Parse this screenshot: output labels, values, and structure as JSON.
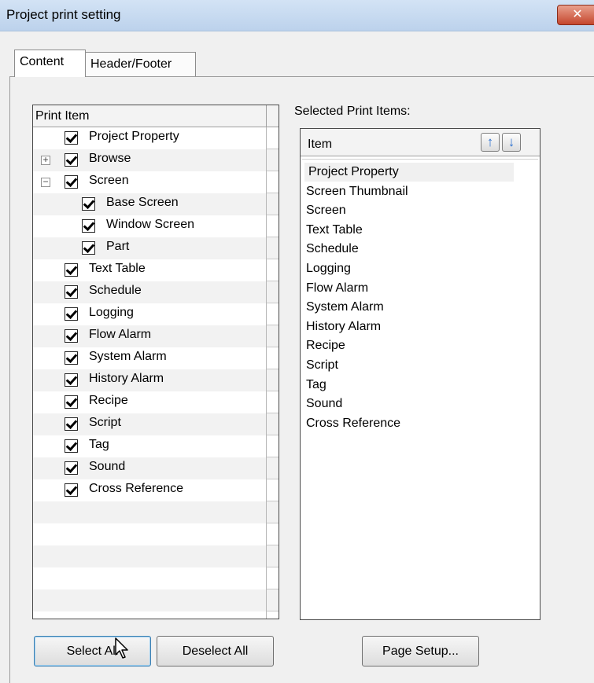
{
  "window": {
    "title": "Project print setting",
    "close_label": "✕"
  },
  "tabs": [
    {
      "label": "Content",
      "active": true
    },
    {
      "label": "Header/Footer",
      "active": false
    }
  ],
  "tree": {
    "header": "Print Item",
    "items": [
      {
        "label": "Project Property",
        "checked": true,
        "level": 1
      },
      {
        "label": "Browse",
        "checked": true,
        "level": 1,
        "expander": "+"
      },
      {
        "label": "Screen",
        "checked": true,
        "level": 1,
        "expander": "−"
      },
      {
        "label": "Base Screen",
        "checked": true,
        "level": 2
      },
      {
        "label": "Window Screen",
        "checked": true,
        "level": 2
      },
      {
        "label": "Part",
        "checked": true,
        "level": 2
      },
      {
        "label": "Text Table",
        "checked": true,
        "level": 0
      },
      {
        "label": "Schedule",
        "checked": true,
        "level": 0
      },
      {
        "label": "Logging",
        "checked": true,
        "level": 0
      },
      {
        "label": "Flow Alarm",
        "checked": true,
        "level": 0
      },
      {
        "label": "System Alarm",
        "checked": true,
        "level": 0
      },
      {
        "label": "History Alarm",
        "checked": true,
        "level": 0
      },
      {
        "label": "Recipe",
        "checked": true,
        "level": 0
      },
      {
        "label": "Script",
        "checked": true,
        "level": 0
      },
      {
        "label": "Tag",
        "checked": true,
        "level": 0
      },
      {
        "label": "Sound",
        "checked": true,
        "level": 0
      },
      {
        "label": "Cross Reference",
        "checked": true,
        "level": 0
      }
    ]
  },
  "selected": {
    "title": "Selected Print Items:",
    "header": "Item",
    "up_icon": "↑",
    "down_icon": "↓",
    "items": [
      "Project Property",
      "Screen Thumbnail",
      "Screen",
      "Text Table",
      "Schedule",
      "Logging",
      "Flow Alarm",
      "System Alarm",
      "History Alarm",
      "Recipe",
      "Script",
      "Tag",
      "Sound",
      "Cross Reference"
    ]
  },
  "buttons": {
    "select_all": "Select All",
    "deselect_all": "Deselect All",
    "page_setup": "Page Setup..."
  },
  "colors": {
    "title_bar": "#c9dcf2",
    "close": "#c5462d",
    "arrow": "#2a6fcf"
  }
}
